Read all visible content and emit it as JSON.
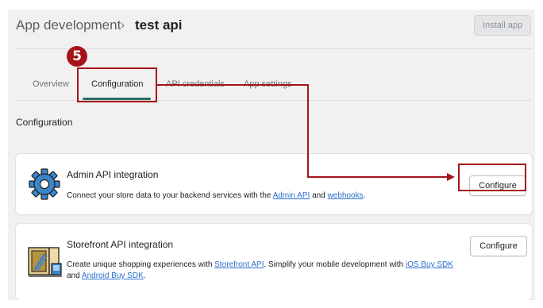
{
  "breadcrumb": {
    "parent": "App development",
    "separator": "›",
    "current": "test api"
  },
  "header": {
    "install_button": "Install app"
  },
  "tabs": [
    {
      "label": "Overview",
      "active": false
    },
    {
      "label": "Configuration",
      "active": true
    },
    {
      "label": "API credentials",
      "active": false
    },
    {
      "label": "App settings",
      "active": false
    }
  ],
  "section": {
    "title": "Configuration"
  },
  "cards": {
    "admin": {
      "title": "Admin API integration",
      "desc_pre": "Connect your store data to your backend services with the ",
      "link1": "Admin API",
      "desc_mid": " and ",
      "link2": "webhooks",
      "desc_post": ".",
      "button": "Configure",
      "icon": "gear-icon"
    },
    "storefront": {
      "title": "Storefront API integration",
      "desc_pre": "Create unique shopping experiences with ",
      "link1": "Storefront API",
      "desc_mid1": ". Simplify your mobile development with ",
      "link2": "iOS Buy SDK",
      "desc_mid2": " and ",
      "link3": "Android Buy SDK",
      "desc_post": ".",
      "button": "Configure",
      "icon": "storefront-icon"
    }
  },
  "annotation": {
    "step": "5"
  },
  "colors": {
    "accent": "#a5141a",
    "tab_underline": "#2c6e63",
    "link": "#2c6ecb",
    "background": "#f1f1f1"
  }
}
